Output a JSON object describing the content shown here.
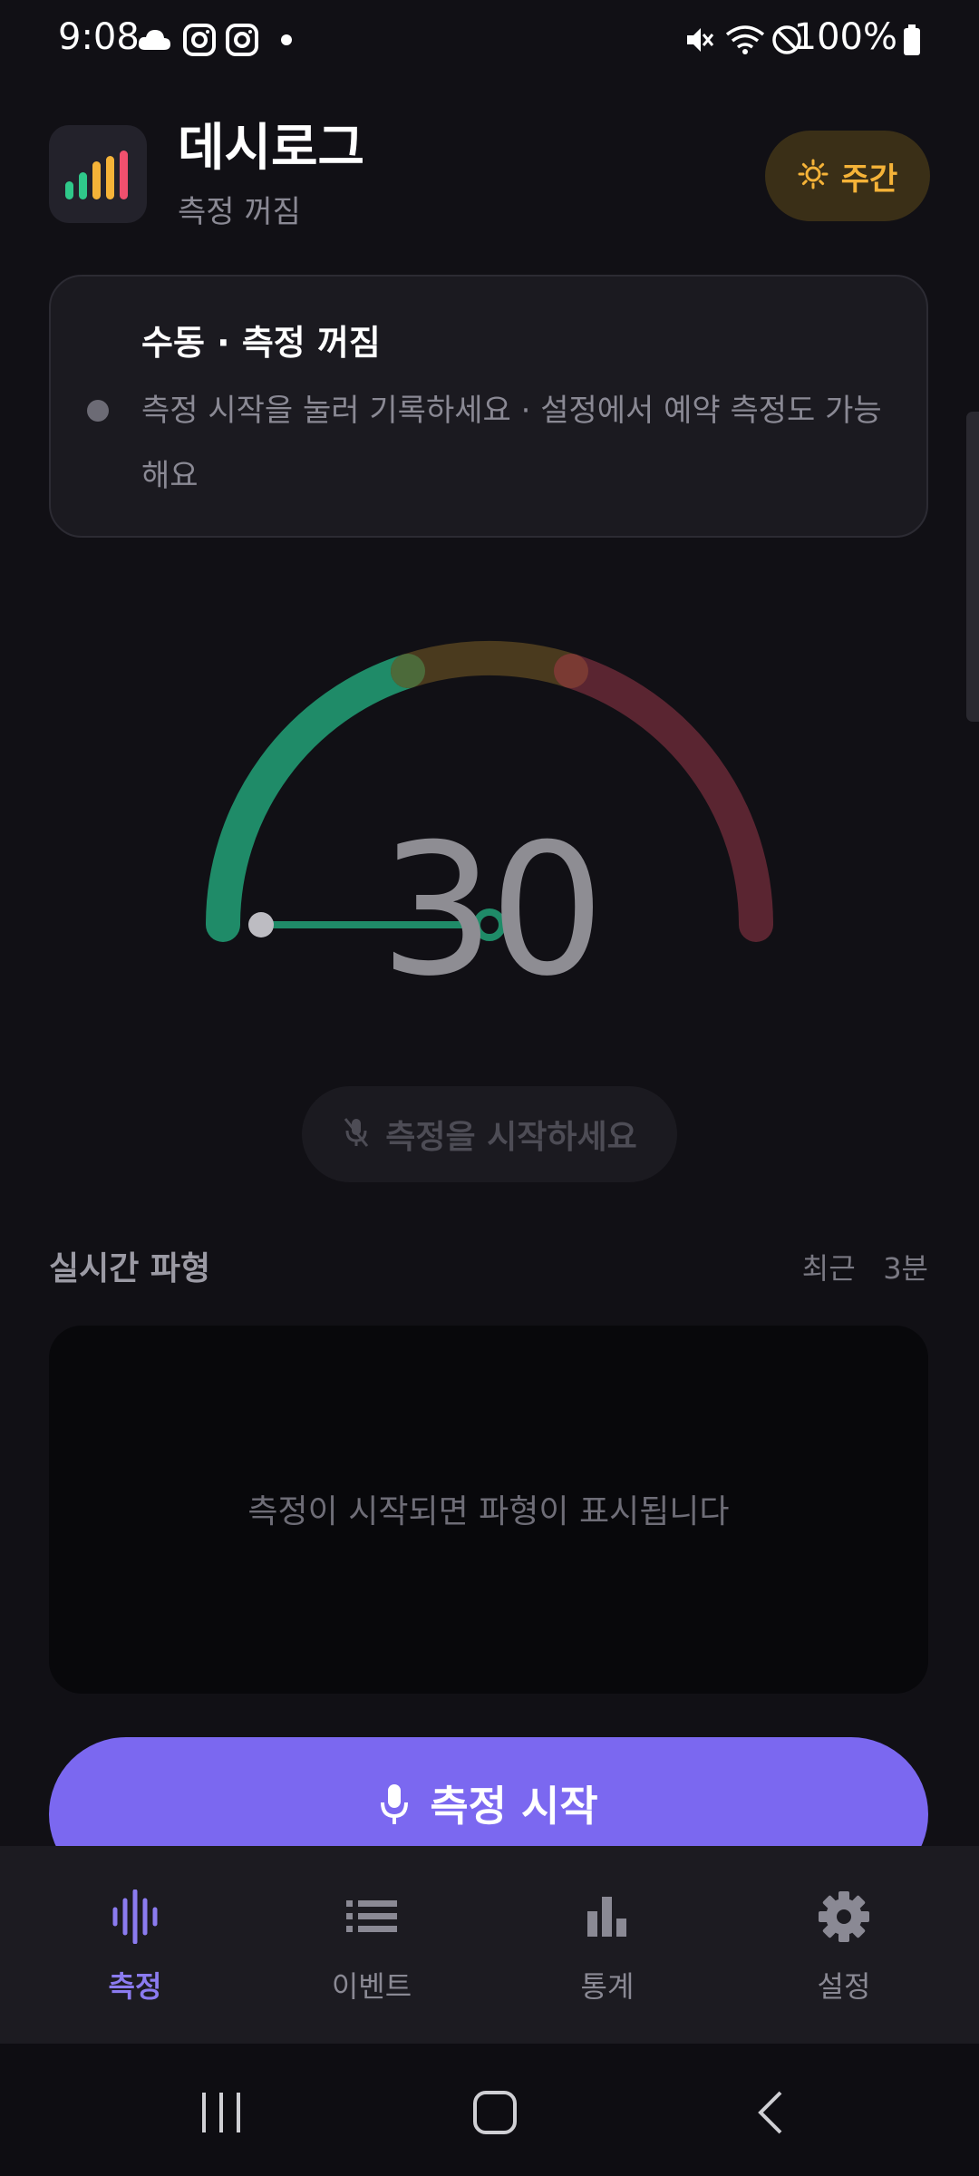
{
  "status_bar": {
    "time": "9:08",
    "battery": "100%",
    "icons": [
      "cloud-icon",
      "instagram-icon",
      "instagram-icon",
      "dot-icon",
      "mute-icon",
      "wifi-icon",
      "do-not-disturb-icon",
      "battery-icon"
    ]
  },
  "header": {
    "app_name": "데시로그",
    "status": "측정 꺼짐",
    "mode_label": "주간",
    "mode_icon": "sun-icon"
  },
  "info_card": {
    "title": "수동 · 측정 꺼짐",
    "description": "측정 시작을 눌러 기록하세요 · 설정에서 예약 측정도 가능해요"
  },
  "gauge": {
    "value": "30",
    "level": 30,
    "colors": {
      "green": "#1f8b68",
      "amber": "#4a3a1e",
      "red": "#5a2531"
    }
  },
  "hint": {
    "label": "측정을 시작하세요",
    "icon": "mic-off-icon"
  },
  "waveform": {
    "title": "실시간 파형",
    "range": "최근   3분",
    "empty_message": "측정이 시작되면 파형이 표시됩니다"
  },
  "start_button": {
    "label": "측정 시작",
    "icon": "mic-icon",
    "color": "#7b68f0"
  },
  "bottom_nav": {
    "items": [
      {
        "label": "측정",
        "icon": "waveform-icon",
        "active": true
      },
      {
        "label": "이벤트",
        "icon": "list-icon",
        "active": false
      },
      {
        "label": "통계",
        "icon": "bar-chart-icon",
        "active": false
      },
      {
        "label": "설정",
        "icon": "gear-icon",
        "active": false
      }
    ]
  },
  "system_nav": [
    "recent-apps-icon",
    "home-icon",
    "back-icon"
  ]
}
